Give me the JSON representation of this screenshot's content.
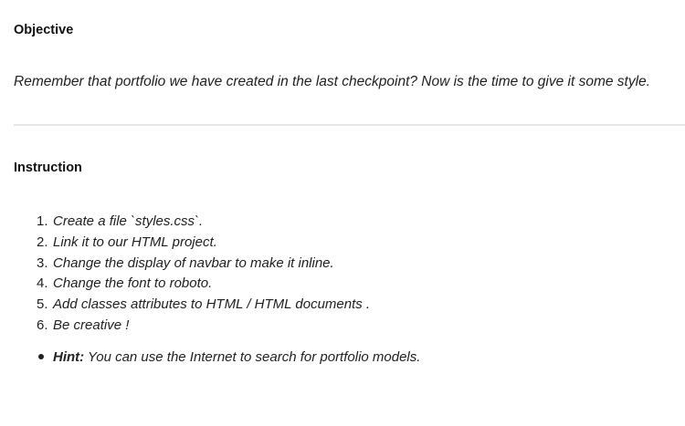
{
  "objective": {
    "heading": "Objective",
    "text": "Remember that portfolio we have created in the last checkpoint? Now is the time to give it some style."
  },
  "instruction": {
    "heading": "Instruction",
    "steps": [
      {
        "num": "1.",
        "text": "Create a file `styles.css`."
      },
      {
        "num": "2.",
        "text": "Link it to our HTML project."
      },
      {
        "num": "3.",
        "text": "Change the display of navbar to make it inline."
      },
      {
        "num": "4.",
        "text": "Change the font to roboto."
      },
      {
        "num": "5.",
        "text": "Add classes attributes to HTML / HTML documents ."
      },
      {
        "num": "6.",
        "text": "Be creative !"
      }
    ],
    "hint": {
      "label": "Hint:",
      "text": " You can use the Internet to search for portfolio models."
    }
  }
}
